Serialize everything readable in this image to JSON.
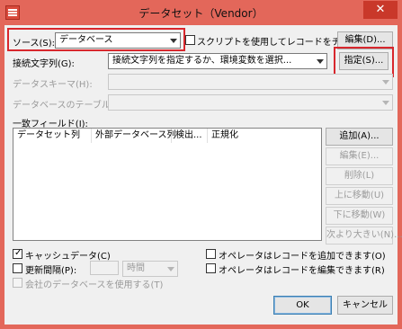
{
  "window": {
    "title": "データセット（Vendor）",
    "close_glyph": "✕"
  },
  "source": {
    "label": "ソース(S):",
    "value": "データベース",
    "script_check_label": "スクリプトを使用してレコードをチェック(H)",
    "edit_button": "編集(D)..."
  },
  "connection": {
    "label": "接続文字列(G):",
    "value": "接続文字列を指定するか、環境変数を選択...",
    "specify_button": "指定(S)..."
  },
  "schema": {
    "label": "データスキーマ(H):",
    "value": ""
  },
  "table": {
    "label": "データベースのテーブル(E):",
    "value": ""
  },
  "match_fields": {
    "label": "一致フィールド(I):",
    "columns": [
      "データセット列",
      "外部データベース列",
      "検出...",
      "正規化"
    ]
  },
  "side_buttons": {
    "add": "追加(A)...",
    "edit": "編集(E)...",
    "delete": "削除(L)",
    "move_up": "上に移動(U)",
    "move_down": "下に移動(W)",
    "next_larger": "次より大きい(N)..."
  },
  "options": {
    "cache_data": "キャッシュデータ(C)",
    "update_interval_label": "更新間隔(P):",
    "interval_unit": "時間",
    "use_company_db": "会社のデータベースを使用する(T)",
    "operator_add": "オペレータはレコードを追加できます(O)",
    "operator_edit": "オペレータはレコードを編集できます(R)"
  },
  "footer": {
    "ok": "OK",
    "cancel": "キャンセル"
  },
  "colors": {
    "frame": "#e3675a",
    "highlight": "#d8272d"
  }
}
